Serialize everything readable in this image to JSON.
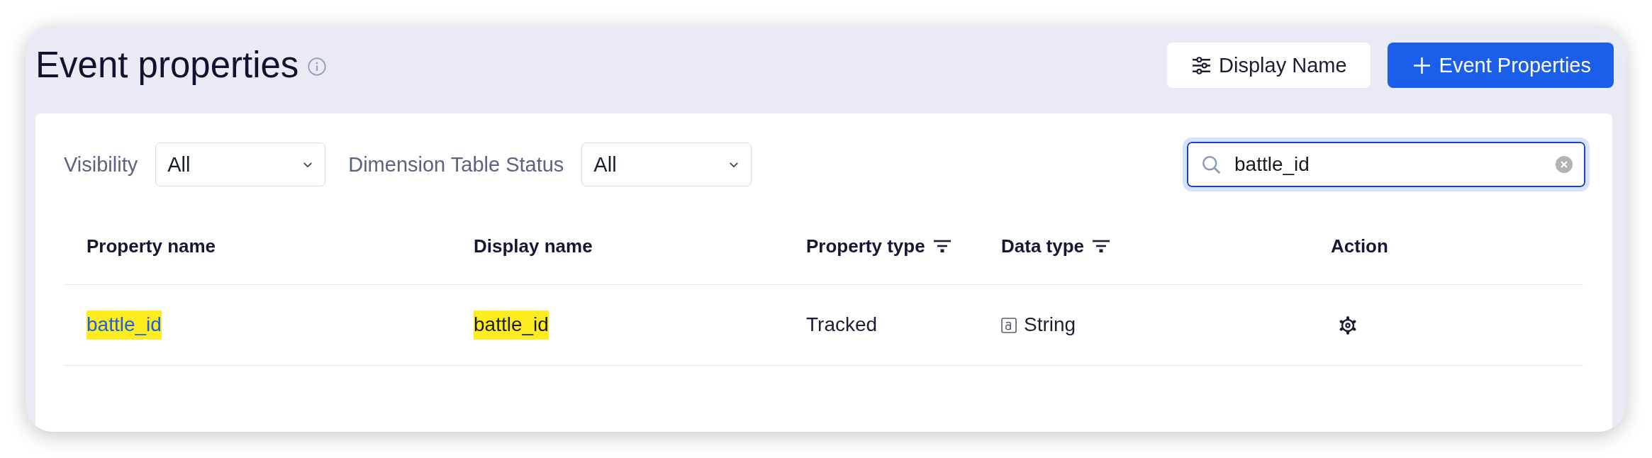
{
  "page": {
    "title": "Event properties"
  },
  "header_buttons": [
    {
      "label": "Display Name",
      "kind": "secondary"
    },
    {
      "label": "Event Properties",
      "kind": "primary"
    }
  ],
  "filters": [
    {
      "label": "Visibility",
      "value": "All"
    },
    {
      "label": "Dimension Table Status",
      "value": "All"
    }
  ],
  "search": {
    "value": "battle_id"
  },
  "table": {
    "columns": [
      {
        "label": "Property name",
        "filterable": false
      },
      {
        "label": "Display name",
        "filterable": false
      },
      {
        "label": "Property type",
        "filterable": true
      },
      {
        "label": "Data type",
        "filterable": true
      },
      {
        "label": "Action",
        "filterable": false
      }
    ],
    "rows": [
      {
        "cells": [
          {
            "kind": "link",
            "text": "battle_id",
            "highlighted": true
          },
          {
            "kind": "text",
            "text": "battle_id",
            "highlighted": true
          },
          {
            "kind": "text",
            "text": "Tracked",
            "highlighted": false
          },
          {
            "kind": "type",
            "text": "String",
            "highlighted": false
          },
          {
            "kind": "action"
          }
        ]
      }
    ]
  }
}
